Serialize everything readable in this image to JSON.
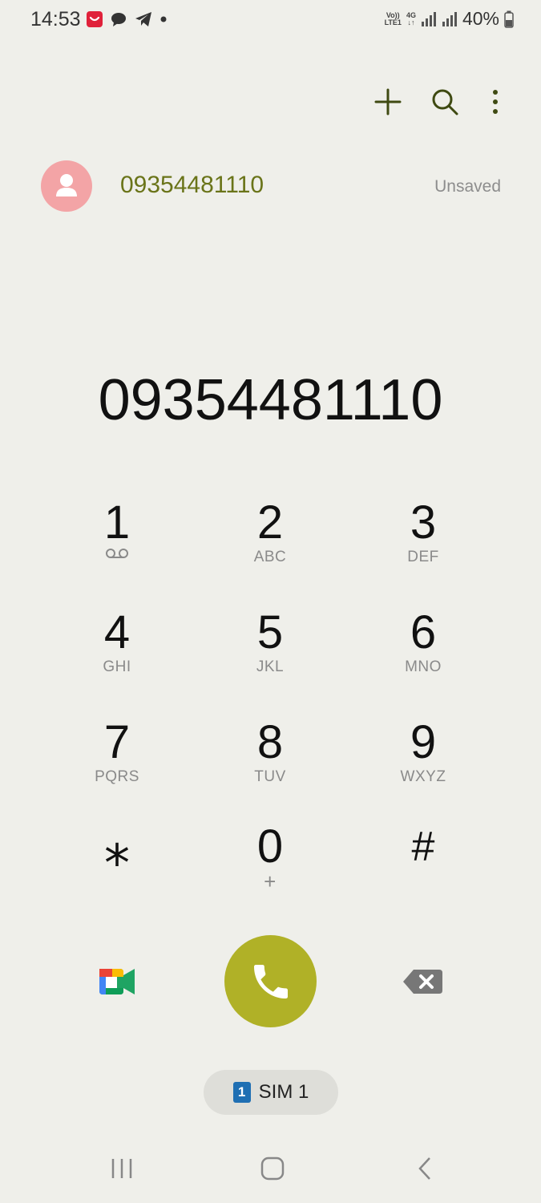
{
  "status_bar": {
    "time": "14:53",
    "network_top": "Vo))",
    "network_bottom": "LTE1",
    "data_type": "4G",
    "battery": "40%"
  },
  "toolbar": {
    "add_icon": "plus-icon",
    "search_icon": "search-icon",
    "more_icon": "more-vertical-icon"
  },
  "suggestion": {
    "number": "09354481110",
    "status": "Unsaved"
  },
  "dialer": {
    "entered_number": "09354481110"
  },
  "keypad": [
    {
      "digit": "1",
      "letters": ""
    },
    {
      "digit": "2",
      "letters": "ABC"
    },
    {
      "digit": "3",
      "letters": "DEF"
    },
    {
      "digit": "4",
      "letters": "GHI"
    },
    {
      "digit": "5",
      "letters": "JKL"
    },
    {
      "digit": "6",
      "letters": "MNO"
    },
    {
      "digit": "7",
      "letters": "PQRS"
    },
    {
      "digit": "8",
      "letters": "TUV"
    },
    {
      "digit": "9",
      "letters": "WXYZ"
    },
    {
      "digit": "*",
      "letters": ""
    },
    {
      "digit": "0",
      "letters": "+"
    },
    {
      "digit": "#",
      "letters": ""
    }
  ],
  "bottom": {
    "sim_number": "1",
    "sim_label": "SIM 1",
    "call_color": "#b0b127"
  }
}
